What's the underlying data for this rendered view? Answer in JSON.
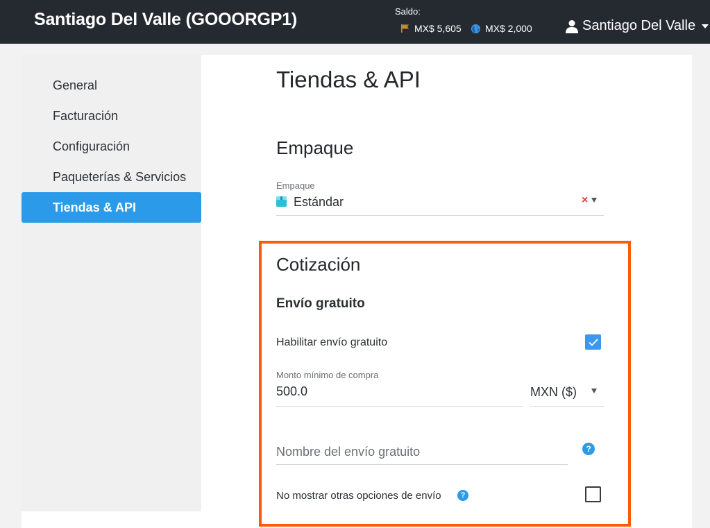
{
  "header": {
    "title": "Santiago Del Valle (GOOORGP1)",
    "saldo_label": "Saldo:",
    "balance_flag": "MX$ 5,605",
    "balance_globe": "MX$ 2,000",
    "user_name": "Santiago Del Valle"
  },
  "sidebar": {
    "items": [
      {
        "label": "General"
      },
      {
        "label": "Facturación"
      },
      {
        "label": "Configuración"
      },
      {
        "label": "Paqueterías & Servicios"
      },
      {
        "label": "Tiendas & API",
        "active": true
      }
    ]
  },
  "main": {
    "page_title": "Tiendas & API",
    "empaque": {
      "section_title": "Empaque",
      "field_label": "Empaque",
      "value": "Estándar",
      "clear_glyph": "×"
    },
    "cotizacion": {
      "section_title": "Cotización",
      "subsection": "Envío gratuito",
      "enable_label": "Habilitar envío gratuito",
      "enable_checked": true,
      "min_amount_label": "Monto mínimo de compra",
      "min_amount_value": "500.0",
      "currency": "MXN ($)",
      "name_placeholder": "Nombre del envío gratuito",
      "help_glyph": "?",
      "hide_options_label": "No mostrar otras opciones de envío",
      "hide_options_checked": false
    }
  },
  "colors": {
    "topbar": "#252a31",
    "accent": "#2b9be9",
    "highlight": "#ff5a06",
    "flag": "#c6893a"
  }
}
